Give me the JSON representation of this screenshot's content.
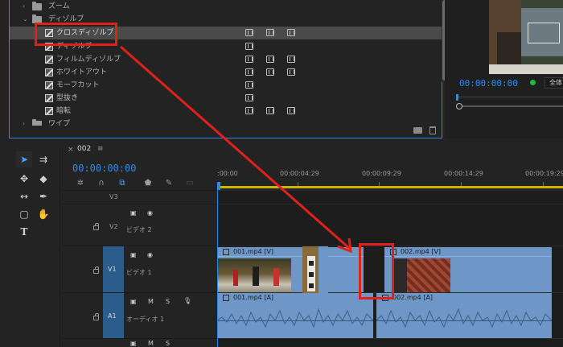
{
  "effects_panel": {
    "items": [
      {
        "label": "ズーム",
        "type": "folder"
      },
      {
        "label": "ディゾルブ",
        "type": "folder"
      },
      {
        "label": "クロスディゾルブ",
        "type": "effect",
        "selected": true,
        "badges": 3
      },
      {
        "label": "ディゾルブ",
        "type": "effect",
        "badges": 1
      },
      {
        "label": "フィルムディゾルブ",
        "type": "effect",
        "badges": 3
      },
      {
        "label": "ホワイトアウト",
        "type": "effect",
        "badges": 3
      },
      {
        "label": "モーフカット",
        "type": "effect",
        "badges": 1
      },
      {
        "label": "型抜き",
        "type": "effect",
        "badges": 1
      },
      {
        "label": "暗転",
        "type": "effect",
        "badges": 3
      },
      {
        "label": "ワイプ",
        "type": "folder"
      }
    ]
  },
  "program_monitor": {
    "timecode": "00:00:00:00",
    "fit_label": "全体"
  },
  "tools": {
    "items": [
      {
        "name": "selection-tool",
        "glyph": "➤"
      },
      {
        "name": "track-select-tool",
        "glyph": "⇉"
      },
      {
        "name": "ripple-edit-tool",
        "glyph": "✥"
      },
      {
        "name": "razor-tool",
        "glyph": "◆"
      },
      {
        "name": "slip-tool",
        "glyph": "↔"
      },
      {
        "name": "pen-tool",
        "glyph": "✒"
      },
      {
        "name": "rectangle-tool",
        "glyph": "▢"
      },
      {
        "name": "hand-tool",
        "glyph": "✋"
      },
      {
        "name": "type-tool",
        "glyph": "T"
      }
    ]
  },
  "timeline": {
    "sequence_name": "002",
    "timecode": "00:00:00:00",
    "ruler_labels": [
      ":00:00",
      "00:00:04:29",
      "00:00:09:29",
      "00:00:14:29",
      "00:00:19:29"
    ],
    "tracks": [
      {
        "id": "V3",
        "name": "",
        "kind": "video"
      },
      {
        "id": "V2",
        "name": "ビデオ 2",
        "kind": "video"
      },
      {
        "id": "V1",
        "name": "ビデオ 1",
        "kind": "video"
      },
      {
        "id": "A1",
        "name": "オーディオ 1",
        "kind": "audio"
      },
      {
        "id": "",
        "name": "",
        "kind": "audio"
      }
    ],
    "toggle_labels": {
      "mute": "M",
      "solo": "S"
    },
    "clips": {
      "v1_a": "001.mp4 [V]",
      "v1_b": "002.mp4 [V]",
      "a1_a": "001.mp4 [A]",
      "a1_b": "002.mp4 [A]"
    }
  },
  "colors": {
    "accent": "#2d8ceb",
    "annotation": "#e0211b",
    "clip": "#6e97c8",
    "work_area": "#ccb400"
  }
}
